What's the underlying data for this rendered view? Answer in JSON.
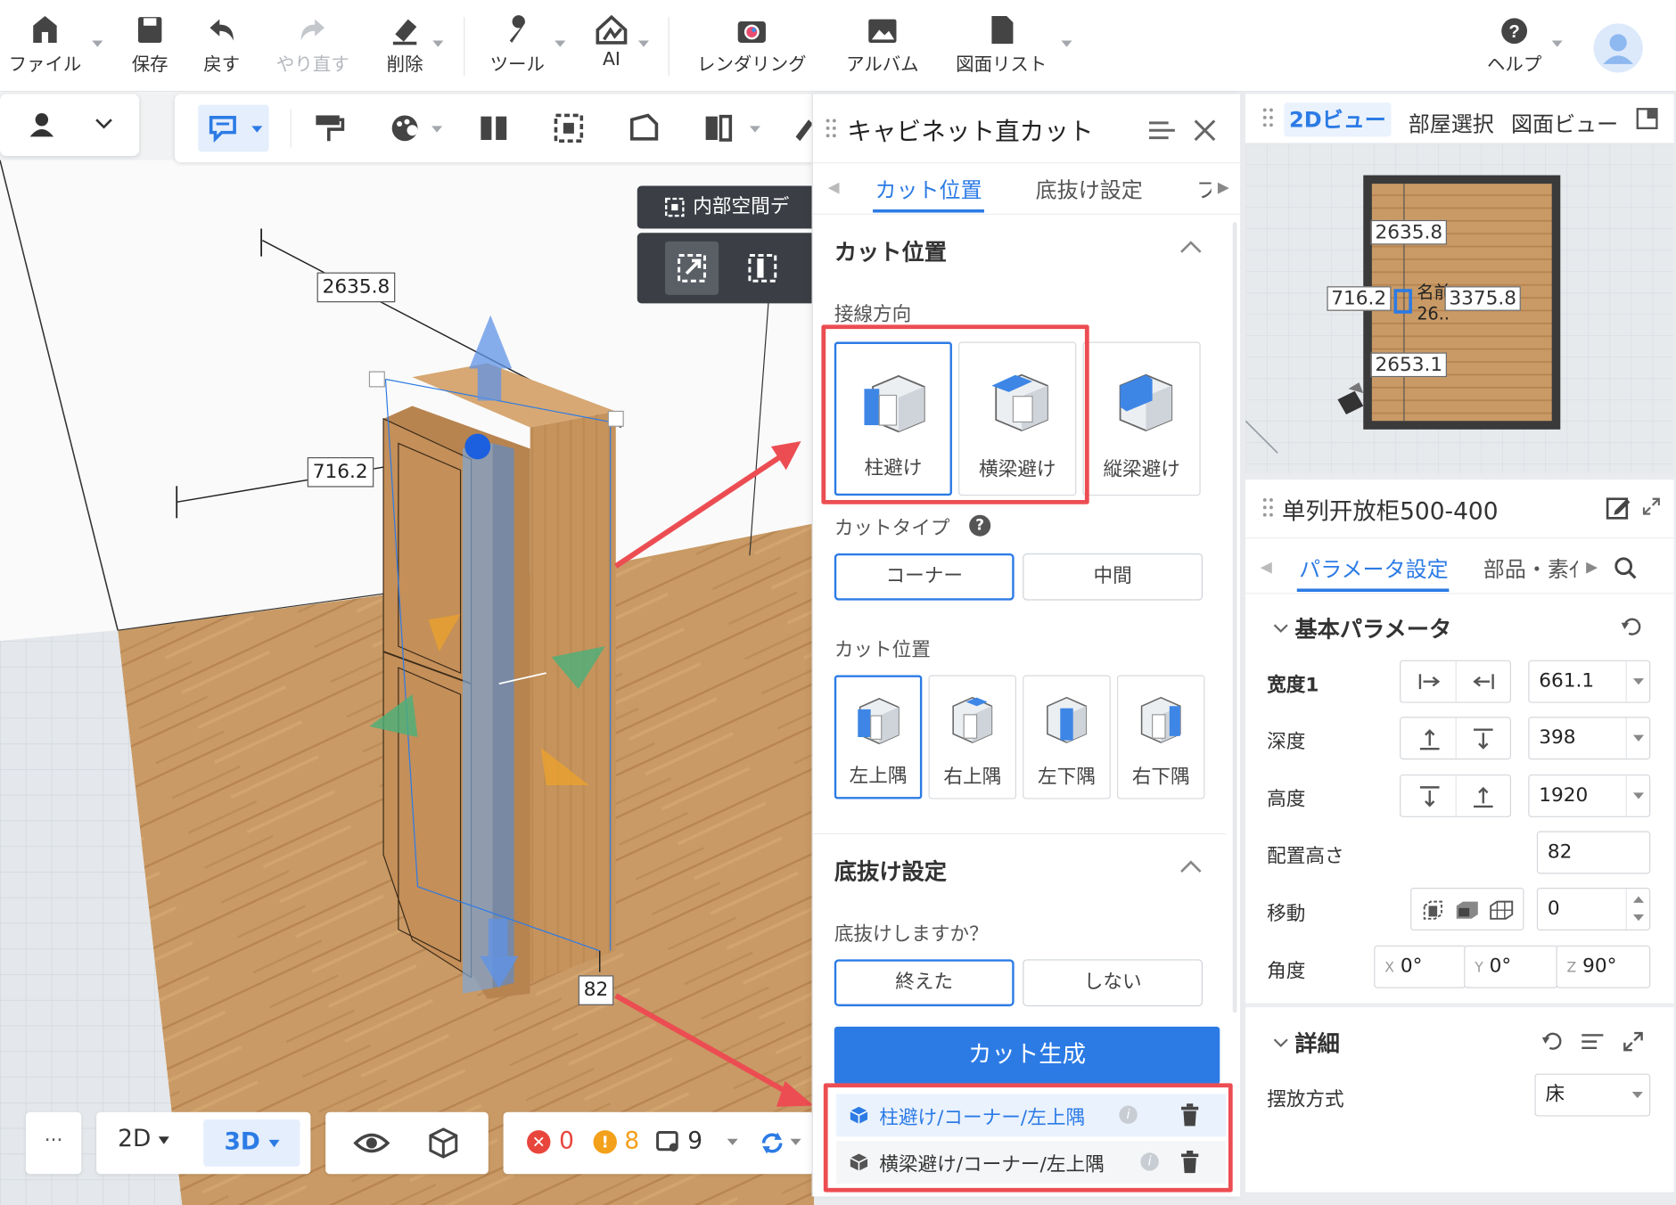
{
  "toolbar": {
    "file": "ファイル",
    "save": "保存",
    "undo": "戻す",
    "redo": "やり直す",
    "delete": "削除",
    "tools": "ツール",
    "ai": "AI",
    "rendering": "レンダリング",
    "album": "アルバム",
    "drawing_list": "図面リスト",
    "help": "ヘルプ"
  },
  "viewport": {
    "interior_space_btn": "内部空間デ",
    "dims": {
      "top": "2635.8",
      "left": "716.2",
      "bottom": "82"
    }
  },
  "cut_panel": {
    "title": "キャビネット直カット",
    "tabs": [
      "カット位置",
      "底抜け設定",
      "フ"
    ],
    "section_cut": "カット位置",
    "tangent_label": "接線方向",
    "tangent_options": [
      "柱避け",
      "横梁避け",
      "縦梁避け"
    ],
    "cut_type_label": "カットタイプ",
    "cut_type_options": [
      "コーナー",
      "中間"
    ],
    "cut_pos_label": "カット位置",
    "cut_pos_options": [
      "左上隅",
      "右上隅",
      "左下隅",
      "右下隅"
    ],
    "section_bottom": "底抜け設定",
    "bottom_question": "底抜けしますか？",
    "bottom_options": [
      "終えた",
      "しない"
    ],
    "generate_btn": "カット生成",
    "results": [
      "柱避け/コーナー/左上隅",
      "横梁避け/コーナー/左上隅"
    ]
  },
  "map_panel": {
    "tabs": [
      "2Dビュー",
      "部屋選択",
      "図面ビュー"
    ],
    "dims": {
      "a": "2635.8",
      "b": "716.2",
      "c": "3375.8",
      "d": "2653.1",
      "name": "名前",
      "sub": "26.."
    }
  },
  "prop_panel": {
    "title": "单列开放柜500-400",
    "tabs": [
      "パラメータ設定",
      "部品・素ｲ"
    ],
    "section_basic": "基本パラメータ",
    "params": {
      "width_label": "宽度1",
      "width_val": "661.1",
      "depth_label": "深度",
      "depth_val": "398",
      "height_label": "高度",
      "height_val": "1920",
      "place_label": "配置高さ",
      "place_val": "82",
      "move_label": "移動",
      "move_val": "0",
      "angle_label": "角度",
      "angle_x_tag": "X",
      "angle_x": "0°",
      "angle_y_tag": "Y",
      "angle_y": "0°",
      "angle_z_tag": "Z",
      "angle_z": "90°"
    },
    "section_detail": "詳細",
    "placement_label": "摆放方式",
    "placement_val": "床"
  },
  "bottom_bar": {
    "more": "···",
    "view2d": "2D",
    "view3d": "3D",
    "errors": "0",
    "warnings": "8",
    "items": "9"
  },
  "colors": {
    "accent": "#2c7be5",
    "highlight": "#ec4d52",
    "wood": "#c9975b"
  }
}
